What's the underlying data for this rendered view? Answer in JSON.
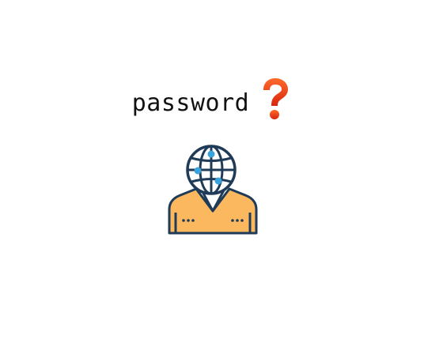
{
  "headline": {
    "word": "password",
    "icon": "red-question-mark-icon"
  },
  "avatar": {
    "icon": "globe-head-person-icon"
  },
  "colors": {
    "text": "#111111",
    "question_mark_red": "#e8401c",
    "outline_navy": "#1f3b57",
    "node_blue": "#3aa3dc",
    "jacket_orange": "#fbb85f"
  }
}
